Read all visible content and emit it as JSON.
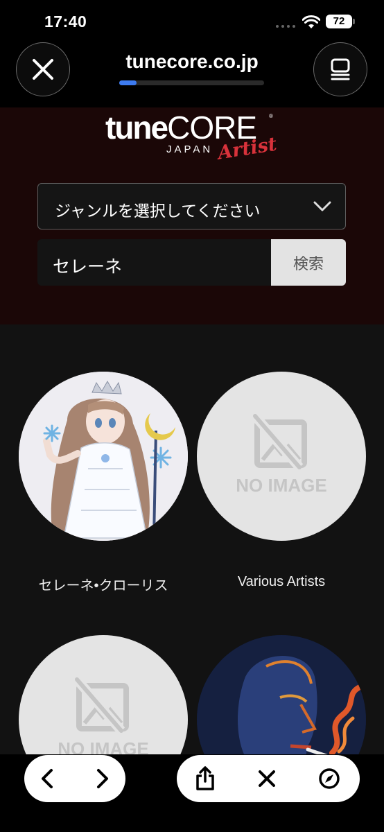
{
  "status_bar": {
    "time": "17:40",
    "battery": "72"
  },
  "browser": {
    "url": "tunecore.co.jp",
    "progress_percent": 12
  },
  "site": {
    "logo": {
      "main_left": "tune",
      "main_right": "CORE",
      "sub": "JAPAN",
      "script": "Artist",
      "trademark": "®"
    },
    "genre_select": {
      "label": "ジャンルを選択してください"
    },
    "search": {
      "value": "セレーネ",
      "button_label": "検索"
    }
  },
  "results": [
    {
      "name": "セレーネ•クローリス",
      "image": "illustration"
    },
    {
      "name": "Various Artists",
      "image": "no-image",
      "placeholder_text": "NO IMAGE"
    },
    {
      "name": "",
      "image": "no-image",
      "placeholder_text": "NO IMAGE"
    },
    {
      "name": "",
      "image": "portrait"
    }
  ],
  "toolbar": {
    "icons": [
      "back-icon",
      "forward-icon",
      "share-icon",
      "close-icon",
      "compass-icon"
    ]
  },
  "colors": {
    "accent_progress": "#3d7bf0",
    "header_bg": "#1b0707",
    "logo_script": "#d8323b"
  }
}
